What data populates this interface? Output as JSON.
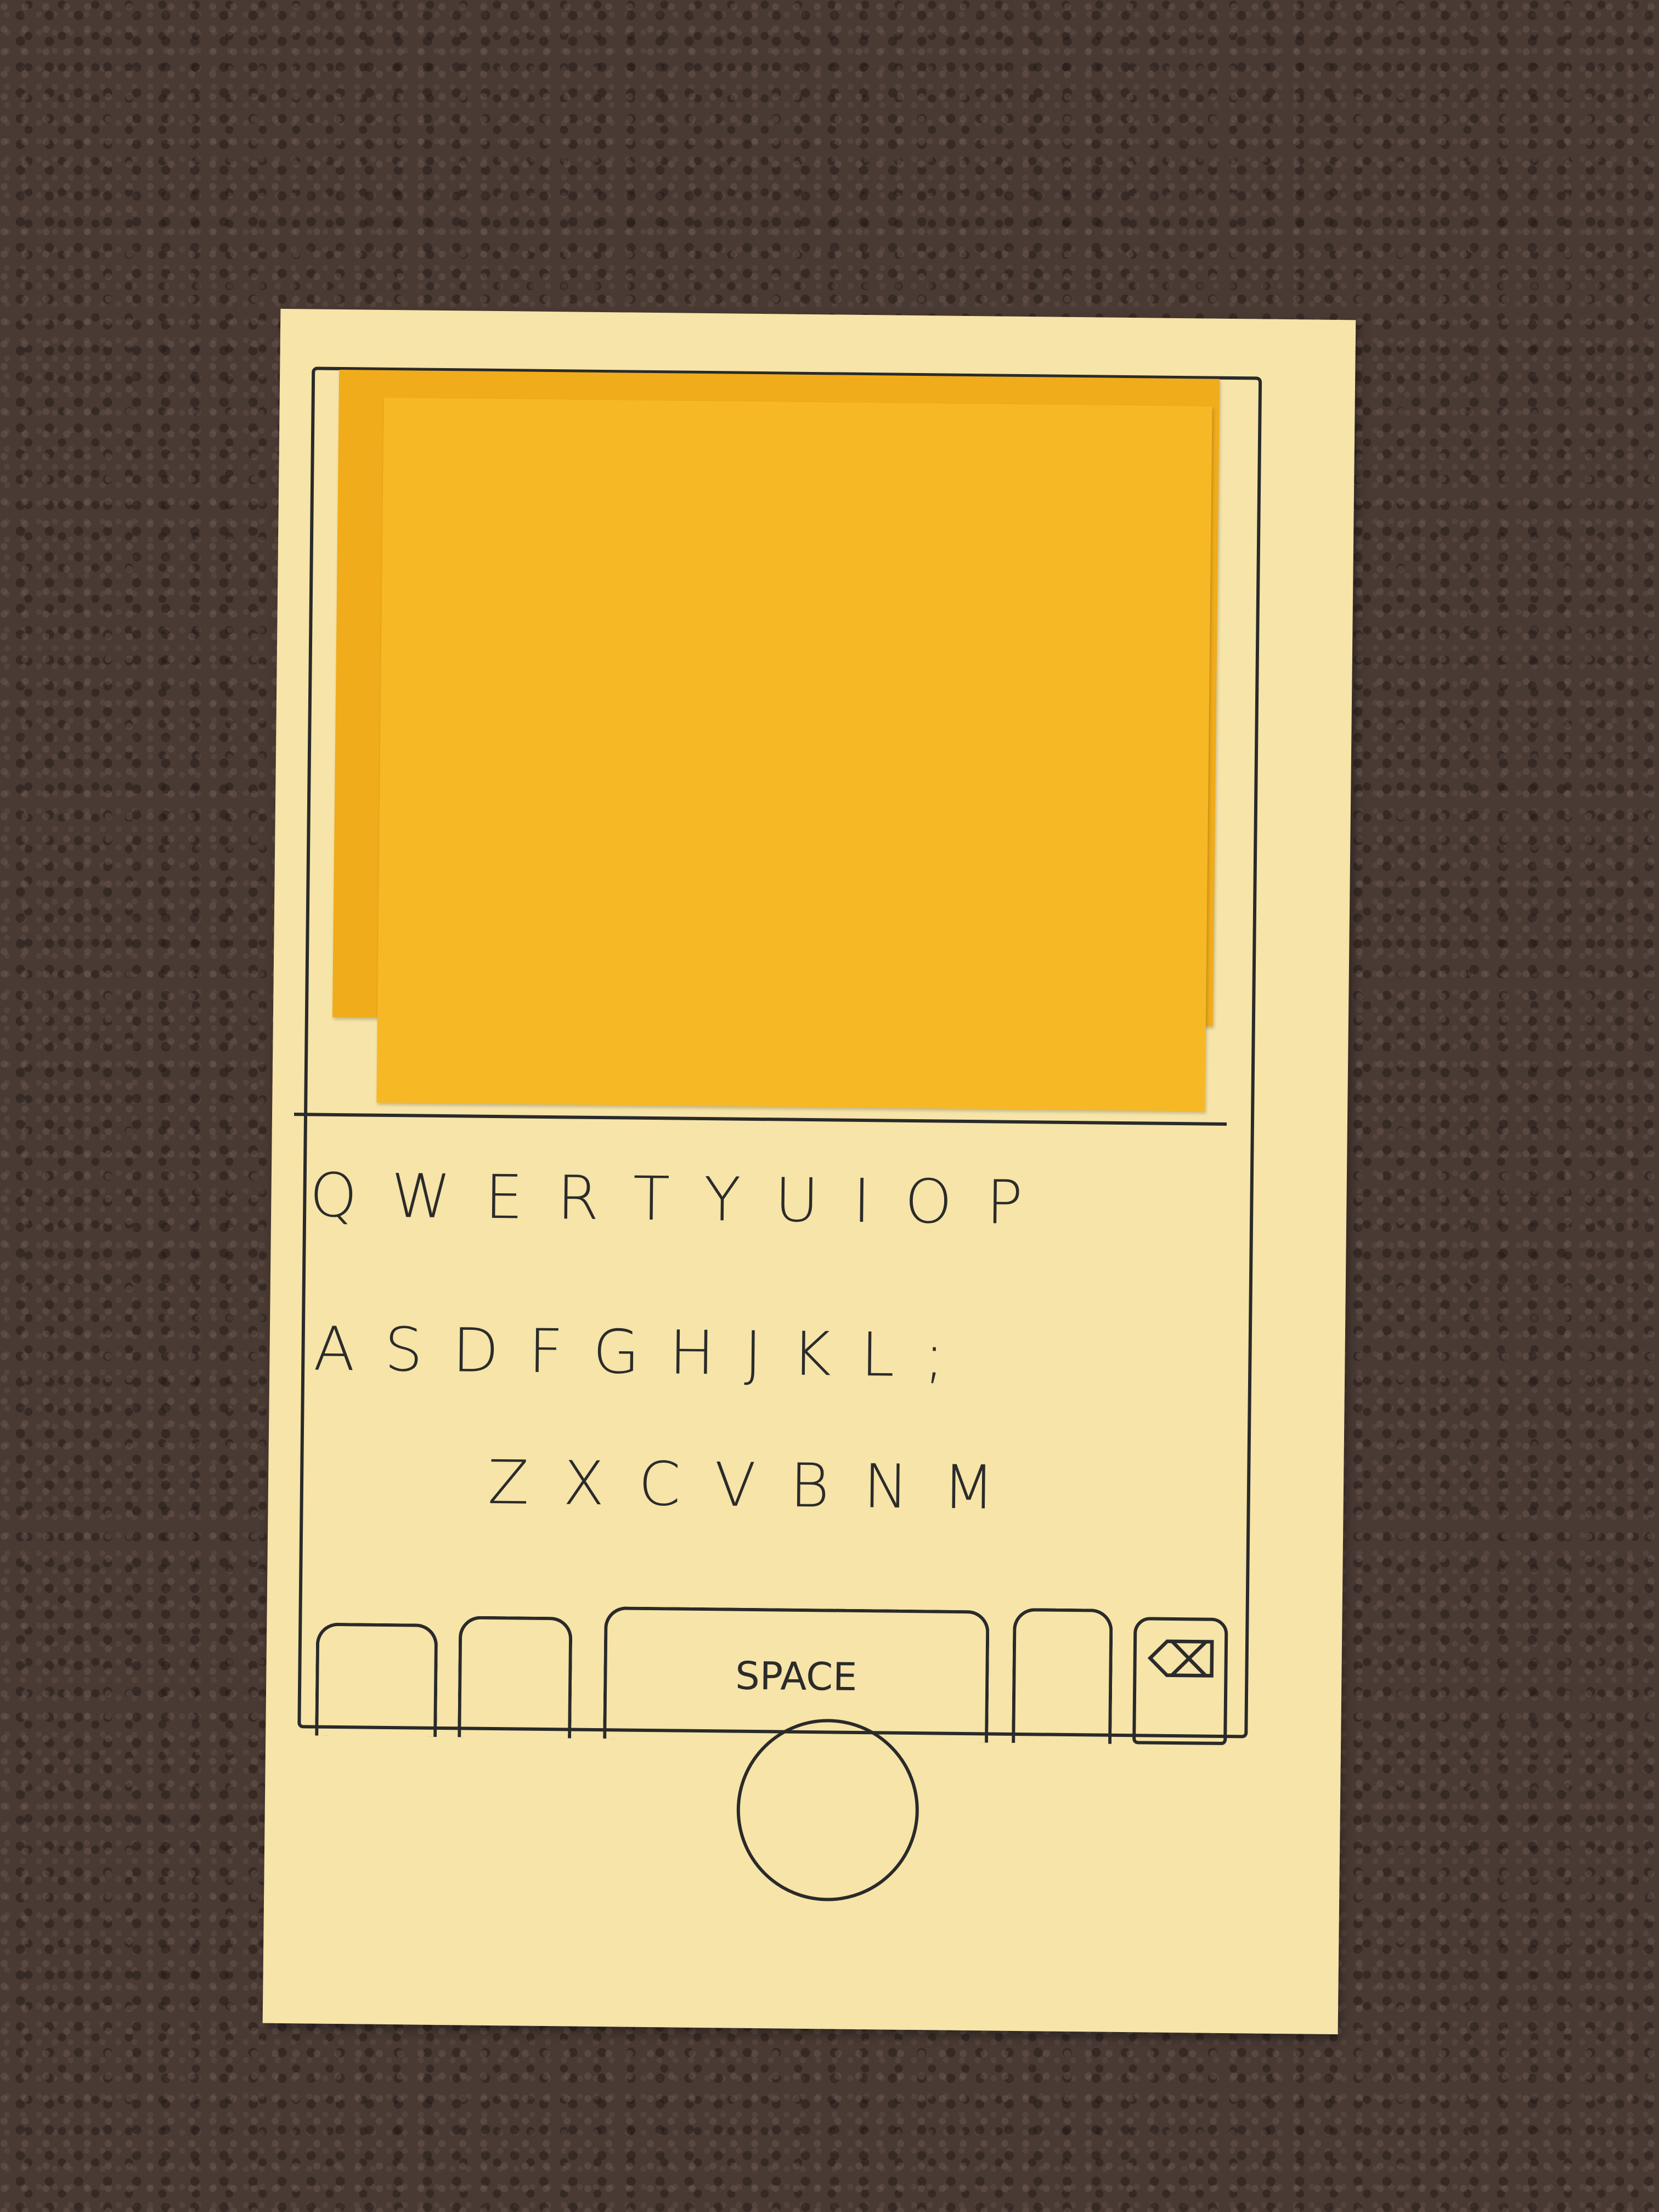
{
  "keyboard": {
    "row1": [
      "Q",
      "W",
      "E",
      "R",
      "T",
      "Y",
      "U",
      "I",
      "O",
      "P"
    ],
    "row2": [
      "A",
      "S",
      "D",
      "F",
      "G",
      "H",
      "J",
      "K",
      "L",
      ";"
    ],
    "row3": [
      "Z",
      "X",
      "C",
      "V",
      "B",
      "N",
      "M"
    ],
    "space_label": "SPACE",
    "delete_icon": "⌫"
  },
  "colors": {
    "paper": "#f6e4a8",
    "sticky_note": "#f7b826",
    "ink": "#2a2a2a",
    "table": "#4a3a34"
  }
}
